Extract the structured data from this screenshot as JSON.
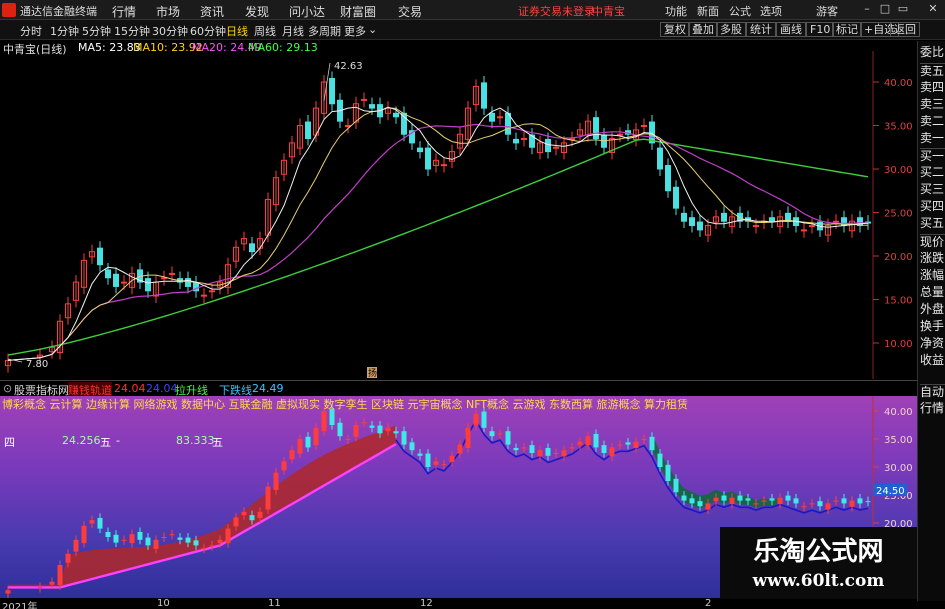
{
  "titlebar": {
    "app_title": "通达信金融终端",
    "menus": [
      "行情",
      "市场",
      "资讯",
      "发现",
      "问小达",
      "财富圈",
      "交易"
    ],
    "alert": "证券交易未登录",
    "stock": "中青宝",
    "right_menus": [
      "功能",
      "新面",
      "公式",
      "选项"
    ],
    "right_menus2": [
      "游客"
    ]
  },
  "toolbar": {
    "timeframes": [
      "分时",
      "1分钟",
      "5分钟",
      "15分钟",
      "30分钟",
      "60分钟",
      "日线",
      "周线",
      "月线",
      "多周期",
      "更多"
    ],
    "active_timeframe": "日线",
    "buttons": [
      "复权",
      "叠加",
      "多股",
      "统计",
      "画线",
      "F10",
      "标记",
      "+自选",
      "返回"
    ]
  },
  "legend": {
    "stock_label": "中青宝(日线)",
    "ma5": "MA5: 23.83",
    "ma10": "MA10: 23.92",
    "ma20": "MA20: 24.49",
    "ma60": "MA60: 29.13"
  },
  "sidepanel": [
    "委比",
    "卖五",
    "卖四",
    "卖三",
    "卖二",
    "卖一",
    "买一",
    "买二",
    "买三",
    "买四",
    "买五",
    "现价",
    "涨跌",
    "涨幅",
    "总量",
    "外盘",
    "换手",
    "净资",
    "收益",
    "自动",
    "行情"
  ],
  "price_axis": [
    "40.00",
    "35.00",
    "30.00",
    "25.00",
    "20.00",
    "15.00",
    "10.00"
  ],
  "annotations": {
    "high": "42.63",
    "low": "7.80",
    "flag": "扬"
  },
  "indicator_header": {
    "name": "股票指标网",
    "label1": "赚钱轨道",
    "value1": "24.04",
    "value2": "24.04",
    "label2": "拉升线",
    "label3": "下跌线",
    "value3": "24.49"
  },
  "concepts": "博彩概念 云计算 边缘计算 网络游戏 数据中心 互联金融 虚拟现实 数字孪生 区块链 元宇宙概念 NFT概念 云游戏 东数西算 旅游概念 算力租赁",
  "stats": {
    "label": "四",
    "v1": "24.256",
    "t1": "五",
    "t2": "-",
    "v2": "83.333",
    "t3": "五"
  },
  "lower_axis": [
    "40.00",
    "35.00",
    "30.00",
    "25.00",
    "20.00"
  ],
  "lower_current": "24.50",
  "date_axis": [
    "2021年",
    "10",
    "11",
    "12",
    "2"
  ],
  "watermark": {
    "line1": "乐淘公式网",
    "line2": "www.60lt.com"
  },
  "colors": {
    "ma5": "#ffffff",
    "ma10": "#ffd700",
    "ma20": "#ff40ff",
    "ma60": "#40ff40",
    "up": "#ff3030",
    "down": "#40e0e0"
  }
}
